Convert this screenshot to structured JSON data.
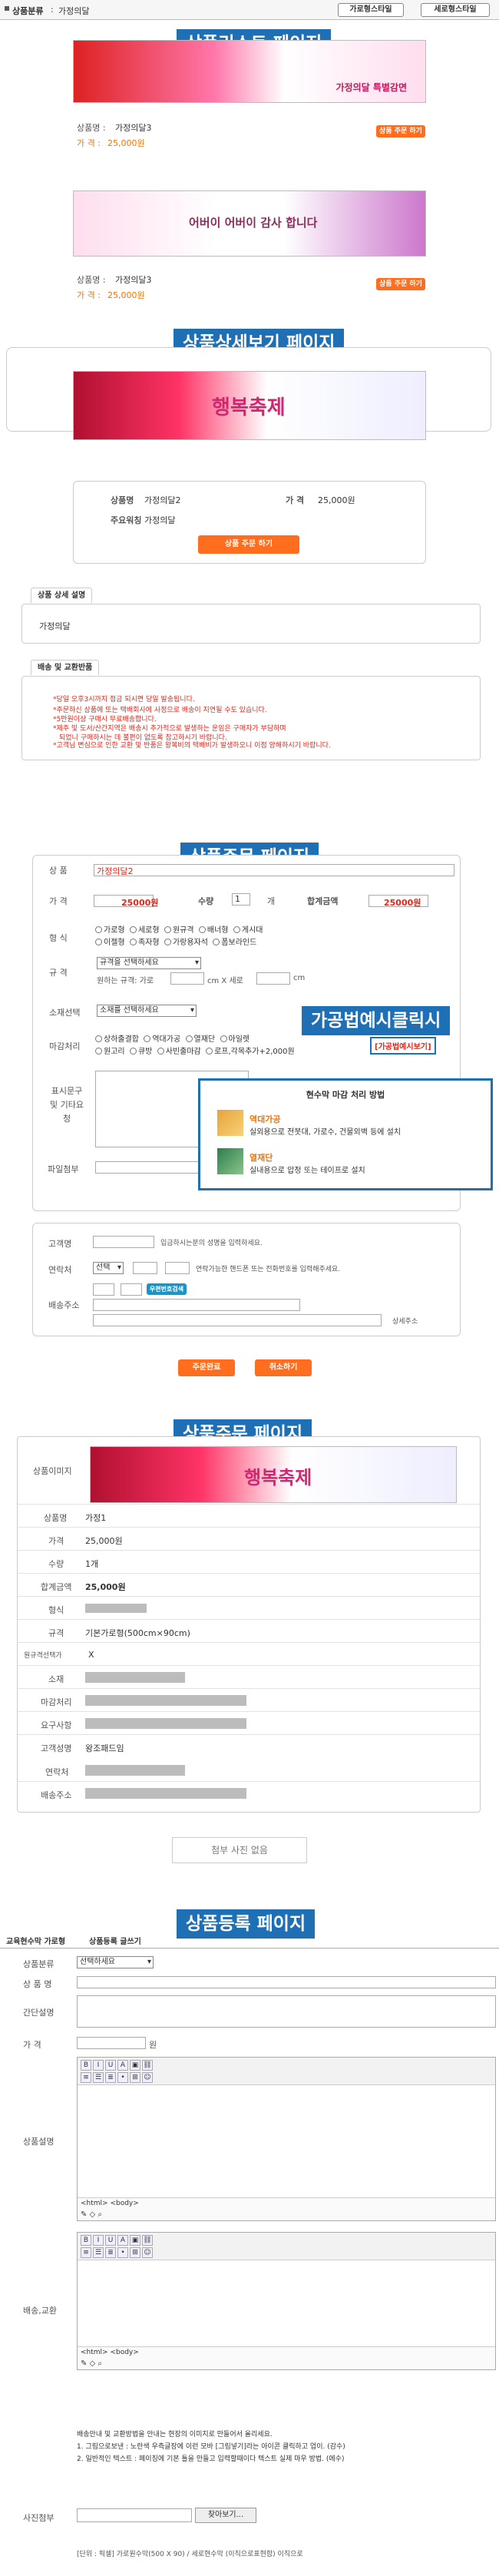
{
  "breadcrumb": {
    "label": "상품분류",
    "sep": ":",
    "category": "가정의달"
  },
  "view_buttons": {
    "grid": "가로형스타일",
    "list": "세로형스타일"
  },
  "sections": {
    "list": "상품리스트 페이지",
    "detail": "상품상세보기 페이지",
    "order": "상품주문 페이지",
    "example": "가공법예시클릭시",
    "order2": "상품주문 페이지",
    "register": "상품등록 페이지"
  },
  "products": [
    {
      "banner_text": "가정의달 특별감면",
      "name_label": "상품명 :",
      "name": "가정의달3",
      "price_label": "가 격 :",
      "price": "25,000원",
      "order_button": "상품 주문 하기"
    },
    {
      "banner_text": "어버이 어버이 감사 합니다",
      "name_label": "상품명 :",
      "name": "가정의달3",
      "price_label": "가 격 :",
      "price": "25,000원",
      "order_button": "상품 주문 하기"
    }
  ],
  "detail": {
    "banner_text": "행복축제",
    "name_label": "상품명",
    "name": "가정의달2",
    "price_label": "가 격",
    "price": "25,000원",
    "spec_label": "주요워칭",
    "spec": "가정의달",
    "order_button": "상품 주문 하기",
    "tab_desc": "상품 상세 설명",
    "desc_text": "가정의달",
    "tab_delivery": "배송 및 교환반품",
    "notices": [
      "*당일 오후3시까지 접금 되시면 당일 발송됩니다.",
      "*주문하신 상품에 또는 택배회사에 사정으로 배송이 지연될 수도 있습니다.",
      "*5만원이상 구매시 무료배송합니다.",
      "*제주 및 도서/산간지역은 배송시 추가적으로 발생하는 운임은 구매자가 부담하며",
      "되었니 구매하시는 데 불편이 없도록 참고하시기 바랍니다.",
      "*고객님 변심으로 인한 교환 및 반품은 왕복비의 택배비가 발생하오니 이점 양해하시기 바랍니다."
    ]
  },
  "order": {
    "name_label": "상 품",
    "name": "가정의달2",
    "price_label": "가 격",
    "price": "25000원",
    "qty_label": "수량",
    "qty": "1",
    "qty_unit": "개",
    "total_label": "합계금액",
    "total": "25000원",
    "form_label": "형 식",
    "form_opts": [
      "가로형",
      "세로형",
      "원규격",
      "배너형",
      "게시대",
      "이젤형",
      "족자형",
      "가랑용자석",
      "폼보라인드"
    ],
    "size_label": "규 격",
    "size_select": "규격을 선택하세요",
    "size_sub": "원하는 규격: 가로",
    "size_x": "cm X 세로",
    "size_cm": "cm",
    "material_label": "소재선택",
    "material_select": "소재를 선택하세요",
    "finish_label": "마감처리",
    "finish_opts": [
      "상하출결합",
      "역대가공",
      "열재단",
      "아일렛",
      "원고리",
      "큐방",
      "사빈출마감",
      "로프,각목추가+2,000원"
    ],
    "finish_link": "[가공법예시보기]",
    "popup_title": "현수막 마감 처리 방법",
    "popup_items": [
      {
        "title": "역대가공",
        "desc": "실외용으로 전봇대, 가로수, 건물외벽 등에 설치"
      },
      {
        "title": "열재단",
        "desc": "실내용으로 압정 또는 테이프로 설치"
      }
    ],
    "request_label": "표시문구 및 기타요청",
    "attach_label": "파일첨부",
    "customer_label": "고객명",
    "customer_hint": "입금하시는분의 성명을 입력하세요.",
    "phone_label": "연락처",
    "phone_select": "선택",
    "phone_hint": "연락가능한 핸드폰 또는 전화번호를 입력해주세요.",
    "address_label": "배송주소",
    "zip_button": "우편번호검색",
    "address_hint": "상세주소",
    "submit": "주문완료",
    "reset": "취소하기"
  },
  "order2": {
    "banner_text": "행복축제",
    "rows": [
      [
        "상품이미지",
        ""
      ],
      [
        "상품명",
        "가정1"
      ],
      [
        "가격",
        "25,000원"
      ],
      [
        "수량",
        "1개"
      ],
      [
        "합계금액",
        "25,000원"
      ],
      [
        "형식",
        ""
      ],
      [
        "규격",
        "기본가로형(500cm×90cm)"
      ],
      [
        "원규격선택가",
        "X"
      ],
      [
        "소재",
        ""
      ],
      [
        "마감처리",
        ""
      ],
      [
        "요구사항",
        ""
      ],
      [
        "고객성명",
        "왕조패드임"
      ],
      [
        "연락처",
        ""
      ],
      [
        "배송주소",
        ""
      ]
    ],
    "no_photo": "첨부 사진 없음"
  },
  "register": {
    "header_tabs": [
      "교육현수막 가로형",
      "상품등록 글쓰기"
    ],
    "cat_label": "상품분류",
    "cat_select": "선택하세요",
    "name_label": "상 품 명",
    "brief_label": "간단설명",
    "price_label": "가 격",
    "price_unit": "원",
    "desc_label": "상품설명",
    "html_tag": "<html> <body>",
    "delivery_label": "배송,교환",
    "help_lines": [
      "배송안내 및 교환방법을 안내는 현장의 이미지로 만들어서 올리세요.",
      "1. 그림으로보낸 : 노란색 우측글장에 이런 모바 [그림넣기]라는 아이콘 클릭하고 업이. (감수)",
      "2. 일반적인 텍스트 : 페이징에 기본 틀을 만들고 입력할때이다 텍스트 실제 마우 방법. (에수)"
    ],
    "photo_label": "사진첨부",
    "browse": "찾아보기...",
    "size_note": "[단위 : 픽셀]    가로원수막(500 X 90) / 세로현수막 (이직으로표현함) 이직으로"
  }
}
